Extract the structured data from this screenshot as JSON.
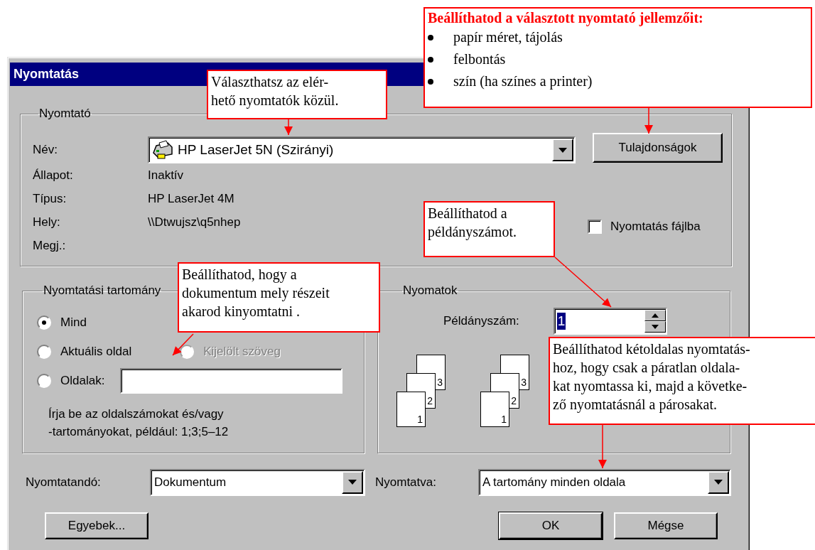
{
  "window": {
    "title": "Nyomtatás"
  },
  "printer": {
    "label": "Nyomtató",
    "name_label": "Név:",
    "name_value": "HP LaserJet 5N (Szirányi)",
    "properties_button": "Tulajdonságok",
    "info": [
      {
        "label": "Állapot:",
        "value": "Inaktív"
      },
      {
        "label": "Típus:",
        "value": "HP LaserJet 4M"
      },
      {
        "label": "Hely:",
        "value": "\\\\Dtwujsz\\q5nhep"
      },
      {
        "label": "Megj.:"
      }
    ],
    "print_to_file": {
      "label": "Nyomtatás fájlba",
      "checked": false
    }
  },
  "range": {
    "label": "Nyomtatási tartomány",
    "options": [
      {
        "label": "Mind",
        "selected": true,
        "disabled": false
      },
      {
        "label": "Aktuális oldal",
        "selected": false,
        "disabled": false
      },
      {
        "label": "Kijelölt szöveg",
        "selected": false,
        "disabled": true
      },
      {
        "label": "Oldalak:",
        "selected": false,
        "disabled": false
      }
    ],
    "hint": [
      "Írja be az oldalszámokat és/vagy",
      "-tartományokat, például: 1;3;5–12"
    ]
  },
  "copies": {
    "label": "Nyomatok",
    "count_label": "Példányszám:",
    "count_value": "1",
    "value_selected": true,
    "stacks": [
      {
        "pages": [
          "3",
          "2",
          "1"
        ]
      },
      {
        "pages": [
          "3",
          "2",
          "1"
        ]
      }
    ]
  },
  "print_what": {
    "label": "Nyomtatandó:",
    "value": "Dokumentum"
  },
  "print_mode": {
    "label": "Nyomtatva:",
    "value": "A tartomány minden oldala"
  },
  "buttons": [
    {
      "label": "Egyebek...",
      "default": false
    },
    {
      "label": "OK",
      "default": true
    },
    {
      "label": "Mégse",
      "default": false
    }
  ],
  "callouts": [
    {
      "kind": "list",
      "title": "Beállíthatod a választott nyomtató jellemzőit:",
      "items": [
        "papír méret, tájolás",
        "felbontás",
        "szín (ha színes a printer)"
      ]
    },
    {
      "kind": "text",
      "lines": [
        "Választhatsz az elér-",
        "hető nyomtatók közül."
      ]
    },
    {
      "kind": "text",
      "lines": [
        "Beállíthatod a",
        "példányszámot."
      ]
    },
    {
      "kind": "text",
      "lines": [
        "Beállíthatod, hogy a",
        "dokumentum mely részeit",
        "akarod kinyomtatni ."
      ]
    },
    {
      "kind": "text",
      "lines": [
        "Beállíthatod kétoldalas nyomtatás-",
        "hoz, hogy csak a páratlan oldala-",
        "kat nyomtassa ki, majd a követke-",
        "ző nyomtatásnál a párosakat."
      ]
    }
  ]
}
